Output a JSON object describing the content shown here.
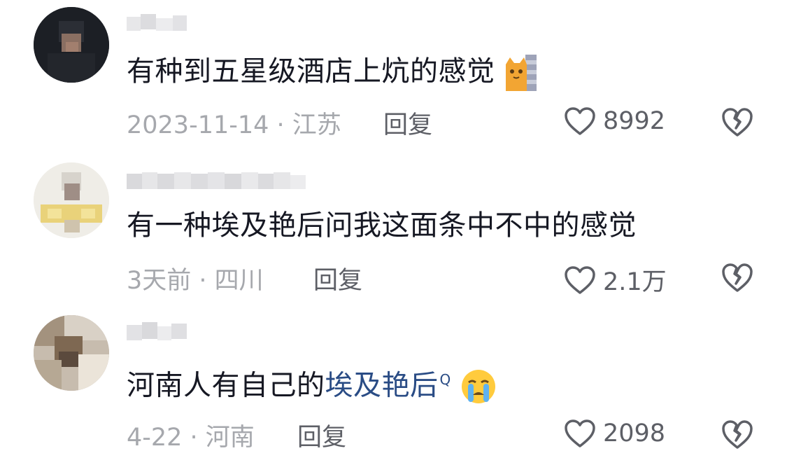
{
  "comments": [
    {
      "text": "有种到五星级酒店上炕的感觉",
      "emoji": "cat-peeking-emoji",
      "meta": "2023-11-14 · 江苏",
      "reply_label": "回复",
      "likes": "8992"
    },
    {
      "text": "有一种埃及艳后问我这面条中不中的感觉",
      "meta": "3天前 · 四川",
      "reply_label": "回复",
      "likes": "2.1万"
    },
    {
      "text_prefix": "河南人有自己的",
      "link_text": "埃及艳后",
      "search_icon": "Q",
      "emoji": "crying-face-emoji",
      "meta": "4-22 · 河南",
      "reply_label": "回复",
      "likes": "2098"
    }
  ],
  "colors": {
    "text": "#161823",
    "meta": "#a6a8ad",
    "action": "#5d5f66",
    "link": "#2a4c85"
  }
}
